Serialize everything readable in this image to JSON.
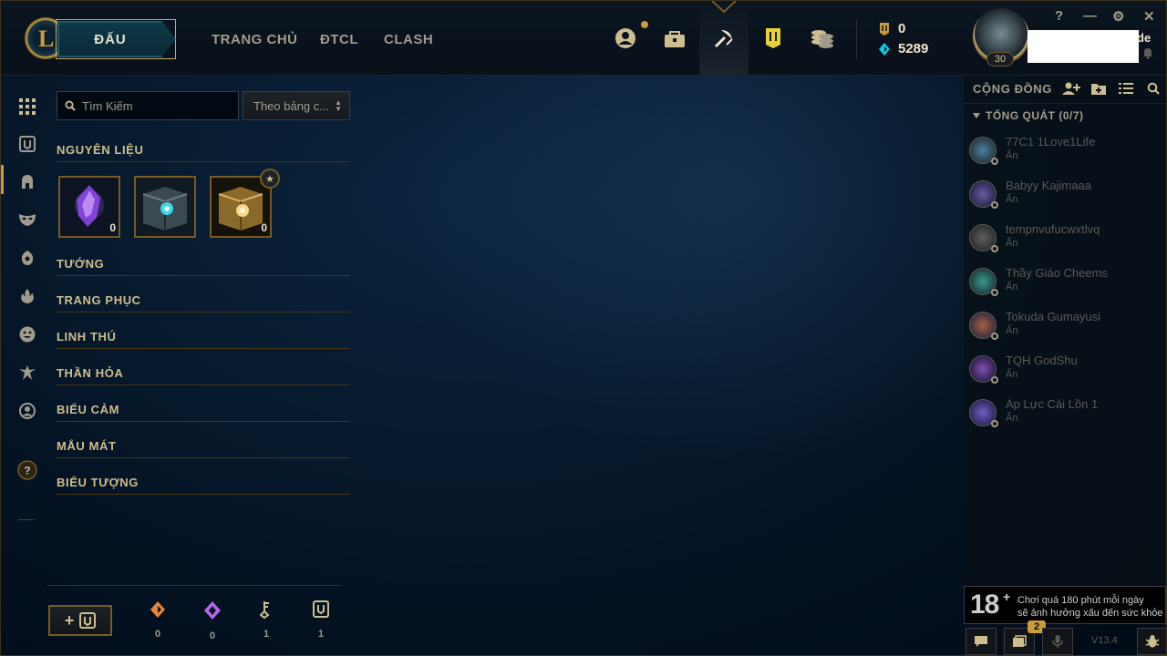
{
  "header": {
    "logo_letter": "L",
    "play_label": "ĐẤU",
    "nav": [
      "TRANG CHỦ",
      "ĐTCL",
      "CLASH"
    ],
    "icons": [
      "profile-icon",
      "collection-icon",
      "loot-icon",
      "clash-banner-icon",
      "store-icon"
    ],
    "currency": {
      "orange_essence": "0",
      "blue_essence": "5289"
    },
    "summoner_level": "30",
    "name_fragment": "de",
    "window_controls": [
      "?",
      "—",
      "⚙",
      "✕"
    ]
  },
  "loot": {
    "search_placeholder": "Tìm Kiếm",
    "sort_value": "Theo bảng c...",
    "categories": {
      "materials": "NGUYÊN LIỆU",
      "champions": "TƯỚNG",
      "skins": "TRANG PHỤC",
      "little_legends": "LINH THÚ",
      "summoner_icons": "THẦN HỎA",
      "emotes": "BIỂU CẢM",
      "ward_skins": "MẮU MÁT",
      "icons": "BIỂU TƯỢNG"
    },
    "material_items": [
      {
        "name": "mythic-essence",
        "count": "0"
      },
      {
        "name": "hextech-chest",
        "count": ""
      },
      {
        "name": "masterwork-chest",
        "count": "0"
      }
    ],
    "footer_materials": [
      {
        "name": "orange-essence",
        "count": "0"
      },
      {
        "name": "mythic-essence",
        "count": "0"
      },
      {
        "name": "key-fragment",
        "count": "1"
      },
      {
        "name": "chest",
        "count": "1"
      }
    ],
    "craft_label": "+"
  },
  "social": {
    "title": "CỘNG ĐỒNG",
    "group": "TỔNG QUÁT (0/7)",
    "friends": [
      {
        "name": "77C1 1Love1Life",
        "status": "Ẩn"
      },
      {
        "name": "Babyy Kajimaaa",
        "status": "Ẩn"
      },
      {
        "name": "tempnvufucwxtlvq",
        "status": "Ẩn"
      },
      {
        "name": "Thầy Giáo Cheems",
        "status": "Ẩn"
      },
      {
        "name": "Tokuda Gumayusi",
        "status": "Ẩn"
      },
      {
        "name": "TQH GodShu",
        "status": "Ẩn"
      },
      {
        "name": "Áp Lực Cái Lồn 1",
        "status": "Ẩn"
      }
    ]
  },
  "footer": {
    "age_rating": "18",
    "age_plus": "+",
    "age_warning_line1": "Chơi quá 180 phút mỗi ngày",
    "age_warning_line2": "sẽ ảnh hưởng xấu đến sức khỏe",
    "missions_badge": "2",
    "version": "V13.4"
  },
  "colors": {
    "gold": "#c89b3c",
    "text": "#cdbe91",
    "muted": "#a09b8c",
    "blue_essence": "#0acbe6",
    "bg": "#010a13"
  }
}
